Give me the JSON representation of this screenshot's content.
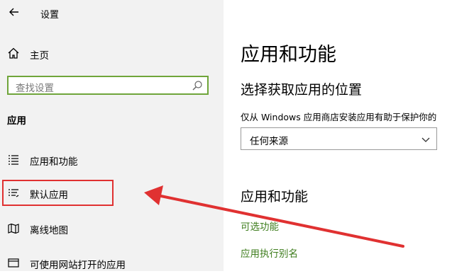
{
  "window": {
    "title": "设置"
  },
  "sidebar": {
    "home_label": "主页",
    "search_placeholder": "查找设置",
    "section_heading": "应用",
    "items": [
      {
        "label": "应用和功能",
        "icon": "list-icon"
      },
      {
        "label": "默认应用",
        "icon": "default-apps-icon"
      },
      {
        "label": "离线地图",
        "icon": "map-icon"
      },
      {
        "label": "可使用网站打开的应用",
        "icon": "web-app-icon"
      }
    ]
  },
  "main": {
    "title": "应用和功能",
    "subheading": "选择获取应用的位置",
    "description": "仅从 Windows 应用商店安装应用有助于保护你的",
    "select_value": "任何来源",
    "section2_heading": "应用和功能",
    "links": [
      "可选功能",
      "应用执行别名"
    ]
  },
  "annotation": {
    "highlight_color": "#e03131",
    "arrow_color": "#e03131"
  },
  "colors": {
    "accent_green": "#6fa53a",
    "link_green": "#3e7d1d",
    "sidebar_bg": "#f2f2f2"
  }
}
